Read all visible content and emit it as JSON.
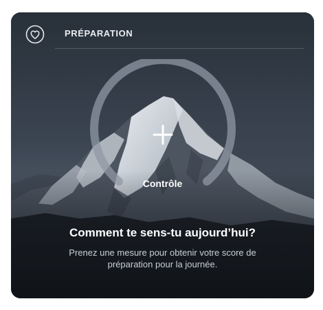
{
  "card": {
    "header_title": "PRÉPARATION",
    "heart_icon": "heart-circle-icon",
    "plus_icon": "plus-icon",
    "check_label": "Contrôle",
    "question": "Comment te sens-tu aujourd’hui?",
    "description": "Prenez une mesure pour obtenir votre score de préparation pour la journée."
  },
  "colors": {
    "sky_top": "#2b323d",
    "sky_bottom": "#55606e",
    "ring": "#8d96a2",
    "text_primary": "#ffffff",
    "text_secondary": "#c9cfd8"
  }
}
